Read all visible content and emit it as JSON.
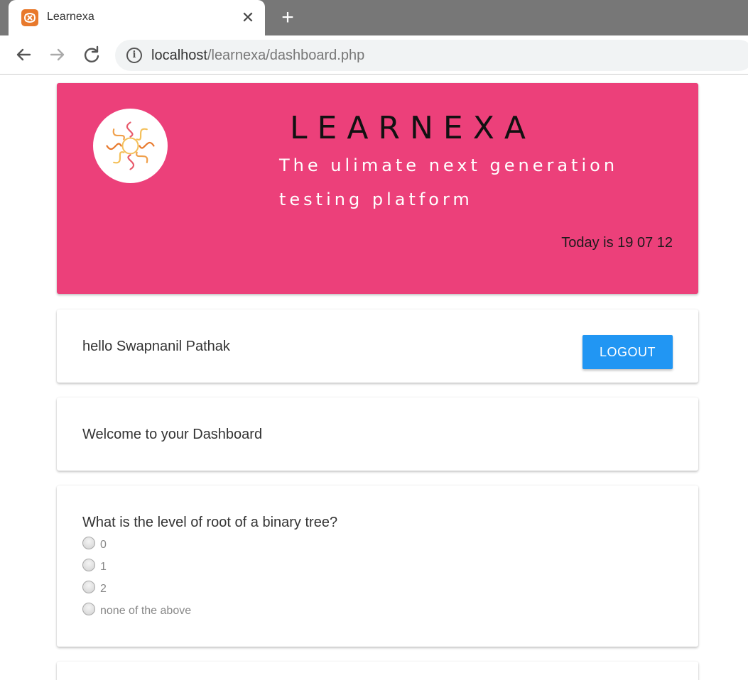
{
  "browser": {
    "tab_title": "Learnexa",
    "url_host": "localhost",
    "url_path": "/learnexa/dashboard.php"
  },
  "header": {
    "brand": "LEARNEXA",
    "tagline_line1": "The ulimate next generation",
    "tagline_line2": "testing platform",
    "today": "Today is 19 07 12"
  },
  "user": {
    "greeting": "hello Swapnanil Pathak",
    "logout_label": "LOGOUT"
  },
  "welcome": {
    "text": "Welcome to your Dashboard"
  },
  "question": {
    "text": "What is the level of root of a binary tree?",
    "options": [
      "0",
      "1",
      "2",
      "none of the above"
    ]
  },
  "colors": {
    "header_bg": "#ec407a",
    "logout_bg": "#2196f3",
    "favicon": "#e8792c"
  },
  "icons": {
    "favicon": "xampp-logo-icon",
    "close": "close-icon",
    "new_tab": "plus-icon",
    "back": "arrow-left-icon",
    "forward": "arrow-right-icon",
    "reload": "reload-icon",
    "info": "info-icon",
    "logo": "sun-swirl-logo-icon"
  }
}
